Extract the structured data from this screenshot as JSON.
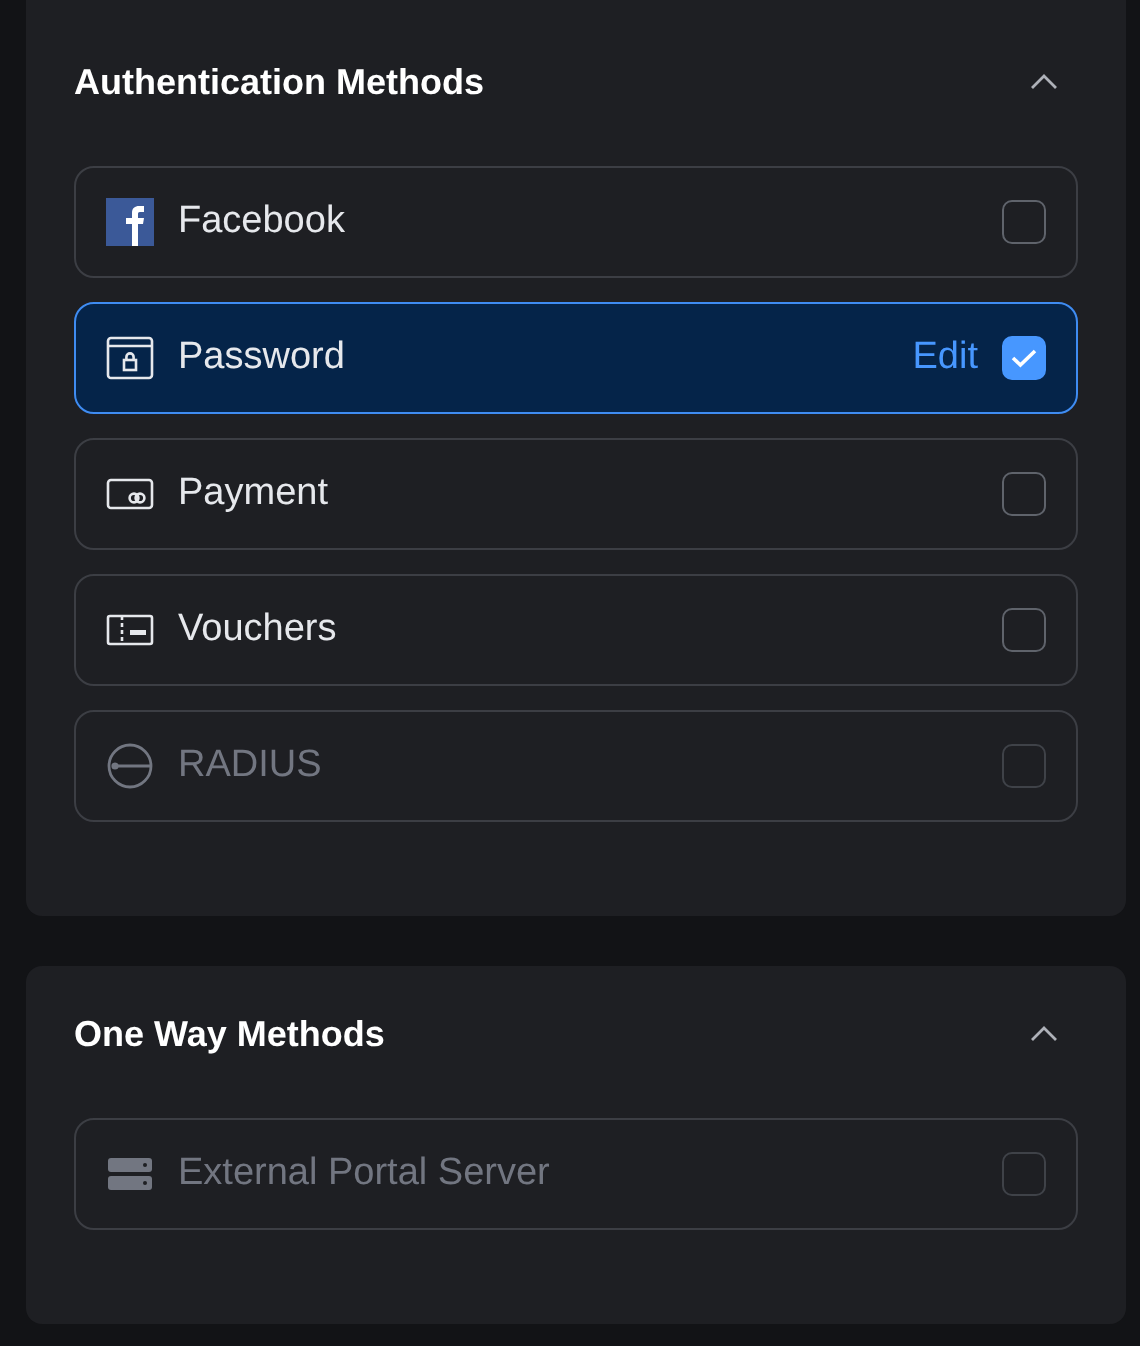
{
  "sections": [
    {
      "title": "Authentication Methods",
      "expanded": true,
      "items": [
        {
          "kind": "facebook",
          "label": "Facebook",
          "selected": false,
          "checked": false,
          "disabled": false
        },
        {
          "kind": "password",
          "label": "Password",
          "selected": true,
          "checked": true,
          "disabled": false,
          "action": "Edit"
        },
        {
          "kind": "payment",
          "label": "Payment",
          "selected": false,
          "checked": false,
          "disabled": false
        },
        {
          "kind": "voucher",
          "label": "Vouchers",
          "selected": false,
          "checked": false,
          "disabled": false
        },
        {
          "kind": "radius",
          "label": "RADIUS",
          "selected": false,
          "checked": false,
          "disabled": true
        }
      ]
    },
    {
      "title": "One Way Methods",
      "expanded": true,
      "items": [
        {
          "kind": "server",
          "label": "External Portal Server",
          "selected": false,
          "checked": false,
          "disabled": true
        }
      ]
    }
  ]
}
